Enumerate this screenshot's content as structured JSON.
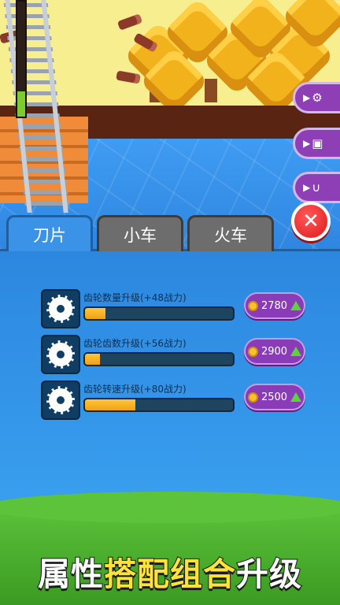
{
  "scene": {
    "track_progress": 0.22,
    "side_buttons": [
      {
        "icon": "video-saw-icon"
      },
      {
        "icon": "video-cart-icon"
      },
      {
        "icon": "video-magnet-icon"
      }
    ],
    "close_glyph": "✕"
  },
  "tabs": [
    {
      "label": "刀片",
      "active": true
    },
    {
      "label": "小车",
      "active": false
    },
    {
      "label": "火车",
      "active": false
    }
  ],
  "upgrades": [
    {
      "label": "齿轮数量升级(+48战力)",
      "progress": 0.14,
      "cost": "2780"
    },
    {
      "label": "齿轮齿数升级(+56战力)",
      "progress": 0.1,
      "cost": "2900"
    },
    {
      "label": "齿轮转速升级(+80战力)",
      "progress": 0.34,
      "cost": "2500"
    }
  ],
  "banner": {
    "part1": "属性",
    "part2": "搭配组合",
    "part3": "升级"
  },
  "colors": {
    "accent_purple": "#8a3cb8",
    "panel_blue": "#2c87df",
    "bar_fill": "#f0a114",
    "close_red": "#e01818"
  }
}
